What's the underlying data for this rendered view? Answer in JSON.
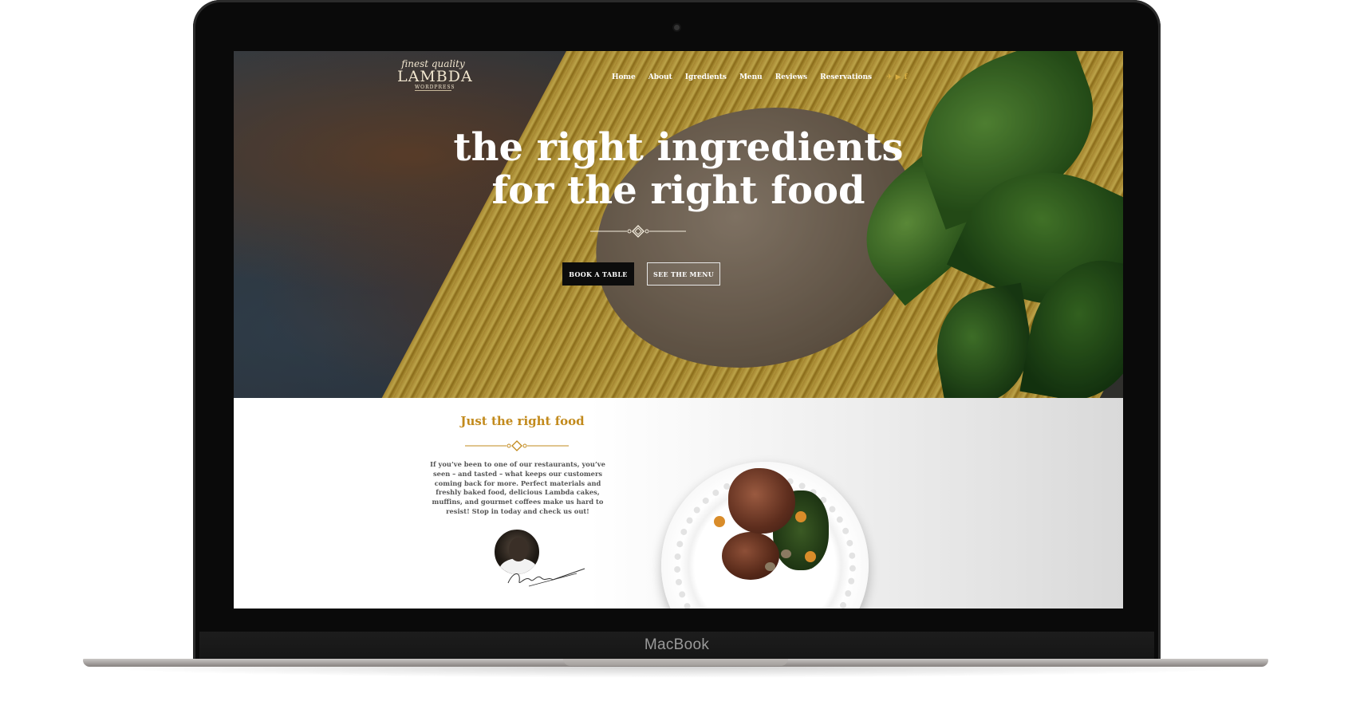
{
  "device": {
    "brand_label": "MacBook"
  },
  "site": {
    "logo": {
      "sup": "finest quality",
      "main": "LAMBDA",
      "sub": "WORDPRESS"
    },
    "nav": {
      "items": [
        "Home",
        "About",
        "Igredients",
        "Menu",
        "Reviews",
        "Reservations"
      ],
      "social_icons": [
        "twitter-icon",
        "youtube-icon",
        "facebook-icon"
      ]
    },
    "hero": {
      "headline_line1": "the right ingredients",
      "headline_line2": "for the right food",
      "book_label": "BOOK A TABLE",
      "menu_label": "SEE THE MENU"
    },
    "about": {
      "title": "Just the right food",
      "text": "If you’ve been to one of our restaurants, you’ve seen – and tasted – what keeps our customers coming back for more. Perfect materials and freshly baked food, delicious Lambda cakes, muffins, and gourmet coffees make us hard to resist! Stop in today and check us out!"
    },
    "colors": {
      "accent": "#c28a1c",
      "social": "#d7ad41",
      "dark_button": "#0c0c0c"
    }
  }
}
